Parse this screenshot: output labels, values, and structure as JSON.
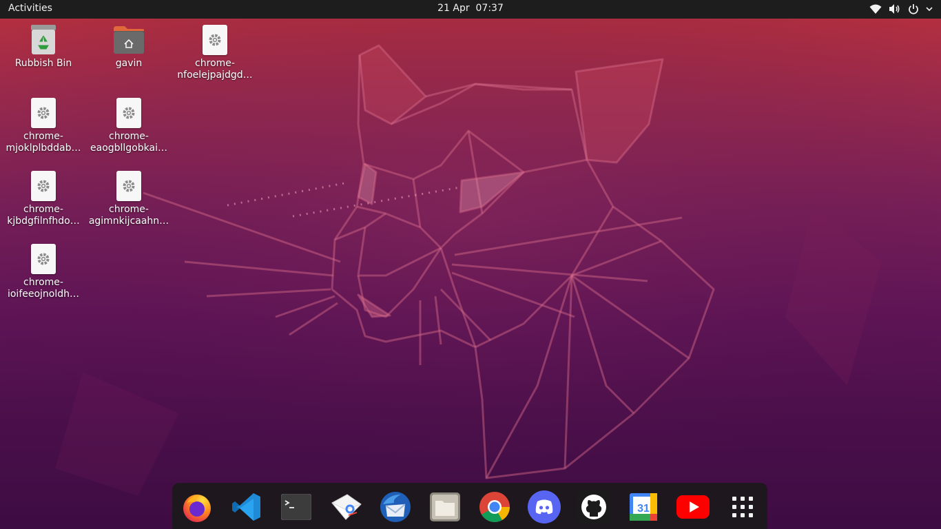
{
  "topbar": {
    "activities": "Activities",
    "clock": "21 Apr  07:37"
  },
  "desktop": {
    "icons": [
      {
        "name": "trash",
        "label": "Rubbish Bin",
        "icon": "recycle-bin-icon"
      },
      {
        "name": "home",
        "label": "gavin",
        "icon": "home-folder-icon"
      },
      {
        "name": "chrome-app-1",
        "label": [
          "chrome-",
          "nfoelejpajdgd…"
        ],
        "icon": "gear-icon"
      },
      {
        "name": "chrome-app-2",
        "label": [
          "chrome-",
          "mjoklplbddab…"
        ],
        "icon": "gear-icon"
      },
      {
        "name": "chrome-app-3",
        "label": [
          "chrome-",
          "eaogbllgobkai…"
        ],
        "icon": "gear-icon"
      },
      {
        "name": "chrome-app-4",
        "label": [
          "chrome-",
          "kjbdgfilnfhdo…"
        ],
        "icon": "gear-icon"
      },
      {
        "name": "chrome-app-5",
        "label": [
          "chrome-",
          "agimnkijcaahn…"
        ],
        "icon": "gear-icon"
      },
      {
        "name": "chrome-app-6",
        "label": [
          "chrome-",
          "ioifeeojnoldh…"
        ],
        "icon": "gear-icon"
      }
    ]
  },
  "dock": {
    "items": [
      "firefox-icon",
      "vscode-icon",
      "terminal-icon",
      "gmail-icon",
      "thunderbird-icon",
      "files-icon",
      "chrome-icon",
      "discord-icon",
      "github-icon",
      "google-calendar-icon",
      "youtube-icon",
      "show-applications-icon"
    ],
    "calendar_day": "31"
  },
  "colors": {
    "topbar": "#1d1d1d",
    "wallpaper_top": "#b8303c",
    "wallpaper_bottom": "#3d0c42"
  }
}
